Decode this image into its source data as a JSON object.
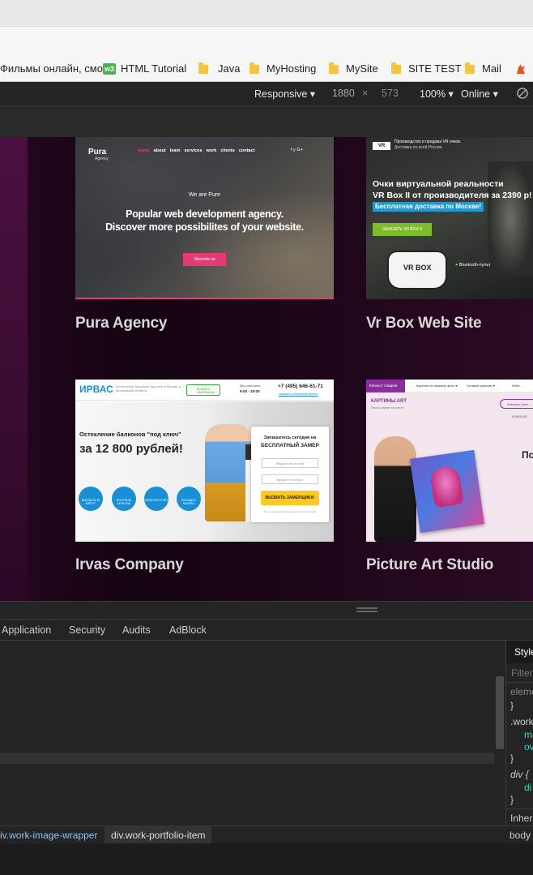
{
  "bookmarks": [
    {
      "label": "Фильмы онлайн, смо",
      "icon": "none"
    },
    {
      "label": "HTML Tutorial",
      "icon": "w3schools-icon"
    },
    {
      "label": "Java",
      "icon": "folder-icon"
    },
    {
      "label": "MyHosting",
      "icon": "folder-icon"
    },
    {
      "label": "MySite",
      "icon": "folder-icon"
    },
    {
      "label": "SITE TEST",
      "icon": "folder-icon"
    },
    {
      "label": "Mail",
      "icon": "folder-icon"
    }
  ],
  "device_toolbar": {
    "mode": "Responsive",
    "width": "1880",
    "times": "×",
    "height": "573",
    "zoom": "100%",
    "network": "Online"
  },
  "portfolio": [
    {
      "title": "Pura Agency"
    },
    {
      "title": "Vr Box Web Site"
    },
    {
      "title": "Irvas Company"
    },
    {
      "title": "Picture Art Studio"
    }
  ],
  "pura": {
    "logo": "Pura",
    "logo_sub": "Agency",
    "nav": [
      "home",
      "about",
      "team",
      "services",
      "work",
      "clients",
      "contact"
    ],
    "social": "f  y  G+",
    "tagline": "We are Pure",
    "headline1": "Popular web development agency.",
    "headline2": "Discover more possibilites of your website.",
    "cta": "Discover us"
  },
  "vrbox": {
    "top1": "Производство и продажа VR очков.",
    "top2": "Доставка по всей России.",
    "badge": "VR",
    "h1": "Очки виртуальной реальности",
    "h2": "VR Box II от производителя за 2390 р!",
    "delivery": "Бесплатная доставка по Москве!",
    "cta": "ЗАКАЗАТЬ VR BOX II",
    "product": "VR BOX",
    "bt": "+ Bluetooth-пульт"
  },
  "irvas": {
    "logo": "ИРВАС",
    "slogan": "Остекление балконов под ключ в Москве и Московской области",
    "callback": "ВЫЗВАТЬ ЗАМЕРЩИКА",
    "hours_label": "Мы работаем:",
    "hours": "9:00 - 18:00",
    "phone": "+7 (495) 646-61-71",
    "phone_sub": "заказать обратный звонок",
    "h1": "Остекление балконов \"под ключ\"",
    "price": "за 12 800 рублей!",
    "badges": [
      "ВЫЕЗД ЗА 30 МИНУТ",
      "БЫСТРЫЙ МОНТАЖ",
      "ГАРАНТИЯ 5 ЛЕТ",
      "ВЫГОДНО МОЖНО"
    ],
    "form_h1": "Запишитесь сегодня на",
    "form_h2": "БЕСПЛАТНЫЙ ЗАМЕР",
    "ph_name": "Введите ваше имя",
    "ph_phone": "Введите телефон",
    "form_btn": "ВЫЗВАТЬ ЗАМЕРЩИКА!",
    "form_note": "Мы не передаем ваши данные третьим лицам"
  },
  "picart": {
    "menu": "Каталог товаров",
    "nav": [
      "Картины по вашему фото ▾",
      "Готовые картины ▾",
      "Work..."
    ],
    "logo": "КАРТИНЫ.ART",
    "slogan": "Печать картин на холсте",
    "btn": "Заказать звон...",
    "phone": "8 (800) 55...",
    "heading": "По"
  },
  "devtools_tabs": [
    "Application",
    "Security",
    "Audits",
    "AdBlock"
  ],
  "styles_pane": {
    "tab": "Style",
    "filter": "Filter",
    "lines": [
      "eleme",
      "}",
      ".work",
      "ma",
      "ov",
      "}",
      "div {",
      "di",
      "}",
      "Inher",
      "body"
    ]
  },
  "breadcrumbs": [
    "iv.work-image-wrapper",
    "div.work-portfolio-item"
  ],
  "colors": {
    "accent": "#e63a77",
    "pura_btn": "#e63a77",
    "vr_blue": "#1a9bd7",
    "vr_green": "#7dbc2a",
    "irvas_blue": "#1a8fd6",
    "irvas_yellow": "#ffc823",
    "picart_purple": "#8a2da0"
  }
}
